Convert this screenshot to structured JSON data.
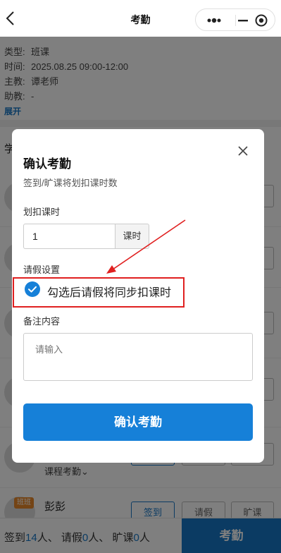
{
  "nav": {
    "title": "考勤"
  },
  "course_info": {
    "type_label": "类型:",
    "type_value": "班课",
    "time_label": "时间:",
    "time_value": "2025.08.25 09:00-12:00",
    "teacher_label": "主教:",
    "teacher_value": "谭老师",
    "assistant_label": "助教:",
    "assistant_value": "-",
    "expand_label": "展开"
  },
  "students_section": {
    "title_partial": "学",
    "course_attendance_label": "课程考勤⌄",
    "last_student": {
      "tag": "班班",
      "name": "彭彭",
      "btn_signin": "签到",
      "btn_leave": "请假",
      "btn_absent": "旷课"
    }
  },
  "bottom_bar": {
    "signin_label": "签到",
    "signin_count": "14",
    "leave_label": "请假",
    "leave_count": "0",
    "absent_label": "旷课",
    "absent_count": "0",
    "unit": "人",
    "sep": "、",
    "action_label": "考勤"
  },
  "modal": {
    "title": "确认考勤",
    "subtitle": "签到/旷课将划扣课时数",
    "deduct_label": "划扣课时",
    "deduct_value": "1",
    "deduct_unit": "课时",
    "leave_label": "请假设置",
    "leave_option": "勾选后请假将同步扣课时",
    "leave_checked": true,
    "remark_label": "备注内容",
    "remark_placeholder": "请输入",
    "confirm_label": "确认考勤"
  },
  "colors": {
    "primary": "#1680d8",
    "annotation": "#e02020"
  }
}
